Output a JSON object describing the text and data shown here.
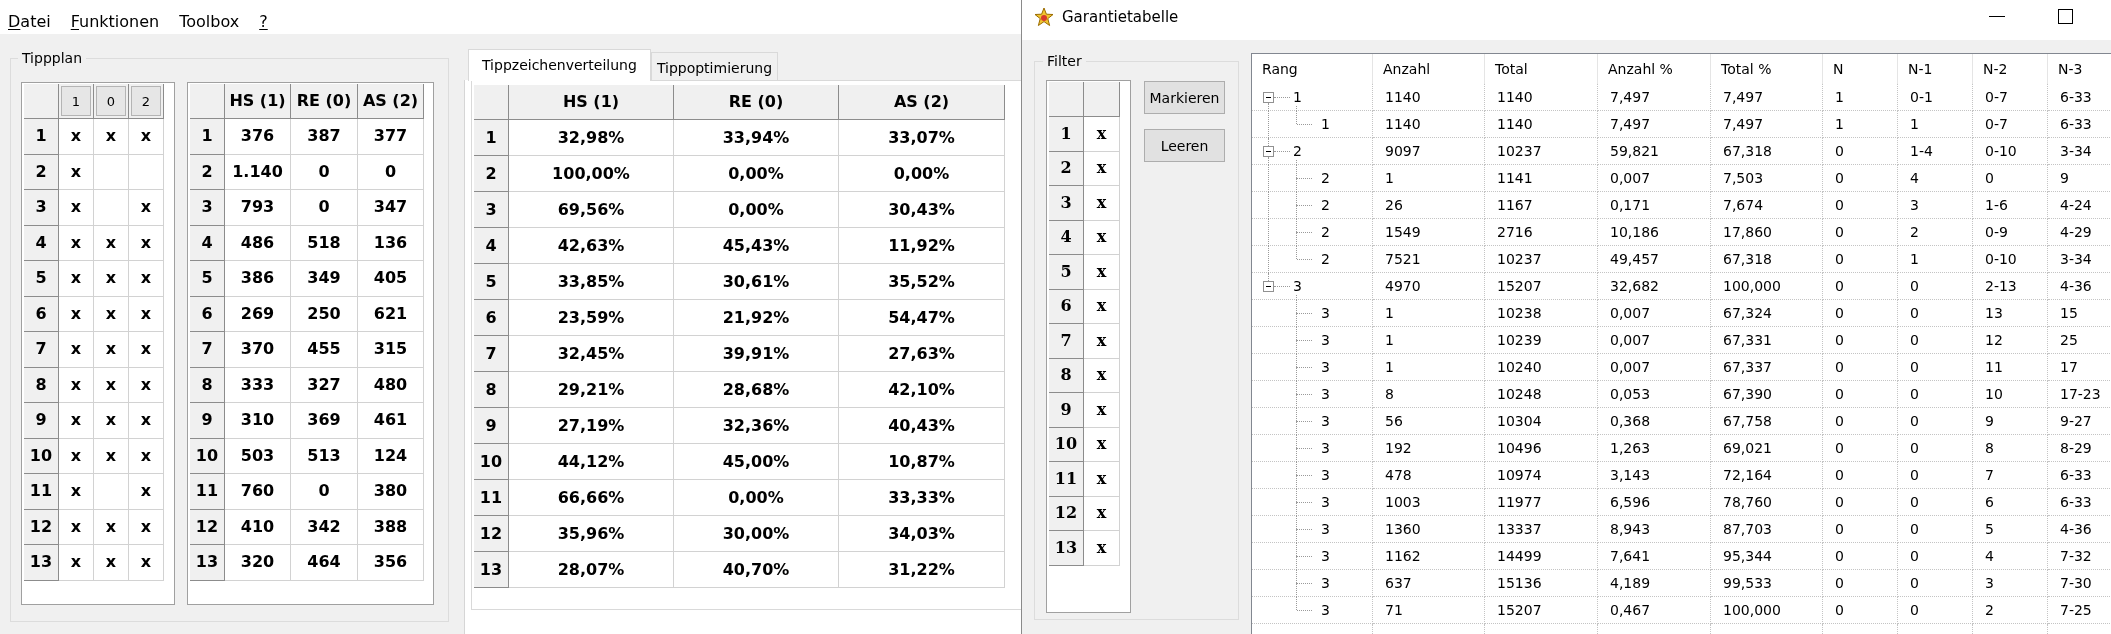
{
  "menu": [
    {
      "label": "Datei",
      "mnemonic": true
    },
    {
      "label": "Funktionen",
      "mnemonic": true
    },
    {
      "label": "Toolbox",
      "mnemonic": false
    },
    {
      "label": "?",
      "mnemonic": true
    }
  ],
  "tippplan": {
    "title": "Tippplan",
    "plan_grid": {
      "columns": [
        "1",
        "0",
        "2"
      ],
      "rows": [
        {
          "label": "1",
          "cells": [
            "x",
            "x",
            "x"
          ]
        },
        {
          "label": "2",
          "cells": [
            "x",
            null,
            null
          ]
        },
        {
          "label": "3",
          "cells": [
            "x",
            null,
            "x"
          ]
        },
        {
          "label": "4",
          "cells": [
            "x",
            "x",
            "x"
          ]
        },
        {
          "label": "5",
          "cells": [
            "x",
            "x",
            "x"
          ]
        },
        {
          "label": "6",
          "cells": [
            "x",
            "x",
            "x"
          ]
        },
        {
          "label": "7",
          "cells": [
            "x",
            "x",
            "x"
          ]
        },
        {
          "label": "8",
          "cells": [
            "x",
            "x",
            "x"
          ]
        },
        {
          "label": "9",
          "cells": [
            "x",
            "x",
            "x"
          ]
        },
        {
          "label": "10",
          "cells": [
            "x",
            "x",
            "x"
          ]
        },
        {
          "label": "11",
          "cells": [
            "x",
            null,
            "x"
          ]
        },
        {
          "label": "12",
          "cells": [
            "x",
            "x",
            "x"
          ]
        },
        {
          "label": "13",
          "cells": [
            "x",
            "x",
            "x"
          ]
        }
      ]
    },
    "count_grid": {
      "columns": [
        "HS (1)",
        "RE (0)",
        "AS (2)"
      ],
      "rows": [
        {
          "label": "1",
          "cells": [
            "376",
            "387",
            "377"
          ]
        },
        {
          "label": "2",
          "cells": [
            "1.140",
            "0",
            "0"
          ]
        },
        {
          "label": "3",
          "cells": [
            "793",
            "0",
            "347"
          ]
        },
        {
          "label": "4",
          "cells": [
            "486",
            "518",
            "136"
          ]
        },
        {
          "label": "5",
          "cells": [
            "386",
            "349",
            "405"
          ]
        },
        {
          "label": "6",
          "cells": [
            "269",
            "250",
            "621"
          ]
        },
        {
          "label": "7",
          "cells": [
            "370",
            "455",
            "315"
          ]
        },
        {
          "label": "8",
          "cells": [
            "333",
            "327",
            "480"
          ]
        },
        {
          "label": "9",
          "cells": [
            "310",
            "369",
            "461"
          ]
        },
        {
          "label": "10",
          "cells": [
            "503",
            "513",
            "124"
          ]
        },
        {
          "label": "11",
          "cells": [
            "760",
            "0",
            "380"
          ]
        },
        {
          "label": "12",
          "cells": [
            "410",
            "342",
            "388"
          ]
        },
        {
          "label": "13",
          "cells": [
            "320",
            "464",
            "356"
          ]
        }
      ]
    }
  },
  "tabs": [
    {
      "label": "Tippzeichenverteilung",
      "selected": true
    },
    {
      "label": "Tippoptimierung",
      "selected": false
    }
  ],
  "distribution_grid": {
    "columns": [
      "HS (1)",
      "RE (0)",
      "AS (2)"
    ],
    "rows": [
      {
        "label": "1",
        "cells": [
          "32,98%",
          "33,94%",
          "33,07%"
        ]
      },
      {
        "label": "2",
        "cells": [
          "100,00%",
          "0,00%",
          "0,00%"
        ]
      },
      {
        "label": "3",
        "cells": [
          "69,56%",
          "0,00%",
          "30,43%"
        ]
      },
      {
        "label": "4",
        "cells": [
          "42,63%",
          "45,43%",
          "11,92%"
        ]
      },
      {
        "label": "5",
        "cells": [
          "33,85%",
          "30,61%",
          "35,52%"
        ]
      },
      {
        "label": "6",
        "cells": [
          "23,59%",
          "21,92%",
          "54,47%"
        ]
      },
      {
        "label": "7",
        "cells": [
          "32,45%",
          "39,91%",
          "27,63%"
        ]
      },
      {
        "label": "8",
        "cells": [
          "29,21%",
          "28,68%",
          "42,10%"
        ]
      },
      {
        "label": "9",
        "cells": [
          "27,19%",
          "32,36%",
          "40,43%"
        ]
      },
      {
        "label": "10",
        "cells": [
          "44,12%",
          "45,00%",
          "10,87%"
        ]
      },
      {
        "label": "11",
        "cells": [
          "66,66%",
          "0,00%",
          "33,33%"
        ]
      },
      {
        "label": "12",
        "cells": [
          "35,96%",
          "30,00%",
          "34,03%"
        ]
      },
      {
        "label": "13",
        "cells": [
          "28,07%",
          "40,70%",
          "31,22%"
        ]
      }
    ]
  },
  "garantie_window": {
    "title": "Garantietabelle",
    "filter": {
      "title": "Filter",
      "rows": [
        {
          "label": "1",
          "value": "x"
        },
        {
          "label": "2",
          "value": "x"
        },
        {
          "label": "3",
          "value": "x"
        },
        {
          "label": "4",
          "value": "x"
        },
        {
          "label": "5",
          "value": "x"
        },
        {
          "label": "6",
          "value": "x"
        },
        {
          "label": "7",
          "value": "x"
        },
        {
          "label": "8",
          "value": "x"
        },
        {
          "label": "9",
          "value": "x"
        },
        {
          "label": "10",
          "value": "x"
        },
        {
          "label": "11",
          "value": "x"
        },
        {
          "label": "12",
          "value": "x"
        },
        {
          "label": "13",
          "value": "x"
        }
      ]
    },
    "buttons": [
      {
        "label": "Markieren"
      },
      {
        "label": "Leeren"
      }
    ],
    "tree": {
      "columns": [
        "Rang",
        "Anzahl",
        "Total",
        "Anzahl %",
        "Total %",
        "N",
        "N-1",
        "N-2",
        "N-3"
      ],
      "rows": [
        {
          "cells": [
            "1",
            "1140",
            "1140",
            "7,497",
            "7,497",
            "1",
            "0-1",
            "0-7",
            "6-33"
          ],
          "expanded": true,
          "children": [
            {
              "cells": [
                "1",
                "1140",
                "1140",
                "7,497",
                "7,497",
                "1",
                "1",
                "0-7",
                "6-33"
              ]
            }
          ]
        },
        {
          "cells": [
            "2",
            "9097",
            "10237",
            "59,821",
            "67,318",
            "0",
            "1-4",
            "0-10",
            "3-34"
          ],
          "expanded": true,
          "children": [
            {
              "cells": [
                "2",
                "1",
                "1141",
                "0,007",
                "7,503",
                "0",
                "4",
                "0",
                "9"
              ]
            },
            {
              "cells": [
                "2",
                "26",
                "1167",
                "0,171",
                "7,674",
                "0",
                "3",
                "1-6",
                "4-24"
              ]
            },
            {
              "cells": [
                "2",
                "1549",
                "2716",
                "10,186",
                "17,860",
                "0",
                "2",
                "0-9",
                "4-29"
              ]
            },
            {
              "cells": [
                "2",
                "7521",
                "10237",
                "49,457",
                "67,318",
                "0",
                "1",
                "0-10",
                "3-34"
              ]
            }
          ]
        },
        {
          "cells": [
            "3",
            "4970",
            "15207",
            "32,682",
            "100,000",
            "0",
            "0",
            "2-13",
            "4-36"
          ],
          "expanded": true,
          "children": [
            {
              "cells": [
                "3",
                "1",
                "10238",
                "0,007",
                "67,324",
                "0",
                "0",
                "13",
                "15"
              ]
            },
            {
              "cells": [
                "3",
                "1",
                "10239",
                "0,007",
                "67,331",
                "0",
                "0",
                "12",
                "25"
              ]
            },
            {
              "cells": [
                "3",
                "1",
                "10240",
                "0,007",
                "67,337",
                "0",
                "0",
                "11",
                "17"
              ]
            },
            {
              "cells": [
                "3",
                "8",
                "10248",
                "0,053",
                "67,390",
                "0",
                "0",
                "10",
                "17-23"
              ]
            },
            {
              "cells": [
                "3",
                "56",
                "10304",
                "0,368",
                "67,758",
                "0",
                "0",
                "9",
                "9-27"
              ]
            },
            {
              "cells": [
                "3",
                "192",
                "10496",
                "1,263",
                "69,021",
                "0",
                "0",
                "8",
                "8-29"
              ]
            },
            {
              "cells": [
                "3",
                "478",
                "10974",
                "3,143",
                "72,164",
                "0",
                "0",
                "7",
                "6-33"
              ]
            },
            {
              "cells": [
                "3",
                "1003",
                "11977",
                "6,596",
                "78,760",
                "0",
                "0",
                "6",
                "6-33"
              ]
            },
            {
              "cells": [
                "3",
                "1360",
                "13337",
                "8,943",
                "87,703",
                "0",
                "0",
                "5",
                "4-36"
              ]
            },
            {
              "cells": [
                "3",
                "1162",
                "14499",
                "7,641",
                "95,344",
                "0",
                "0",
                "4",
                "7-32"
              ]
            },
            {
              "cells": [
                "3",
                "637",
                "15136",
                "4,189",
                "99,533",
                "0",
                "0",
                "3",
                "7-30"
              ]
            },
            {
              "cells": [
                "3",
                "71",
                "15207",
                "0,467",
                "100,000",
                "0",
                "0",
                "2",
                "7-25"
              ]
            }
          ]
        }
      ]
    }
  }
}
